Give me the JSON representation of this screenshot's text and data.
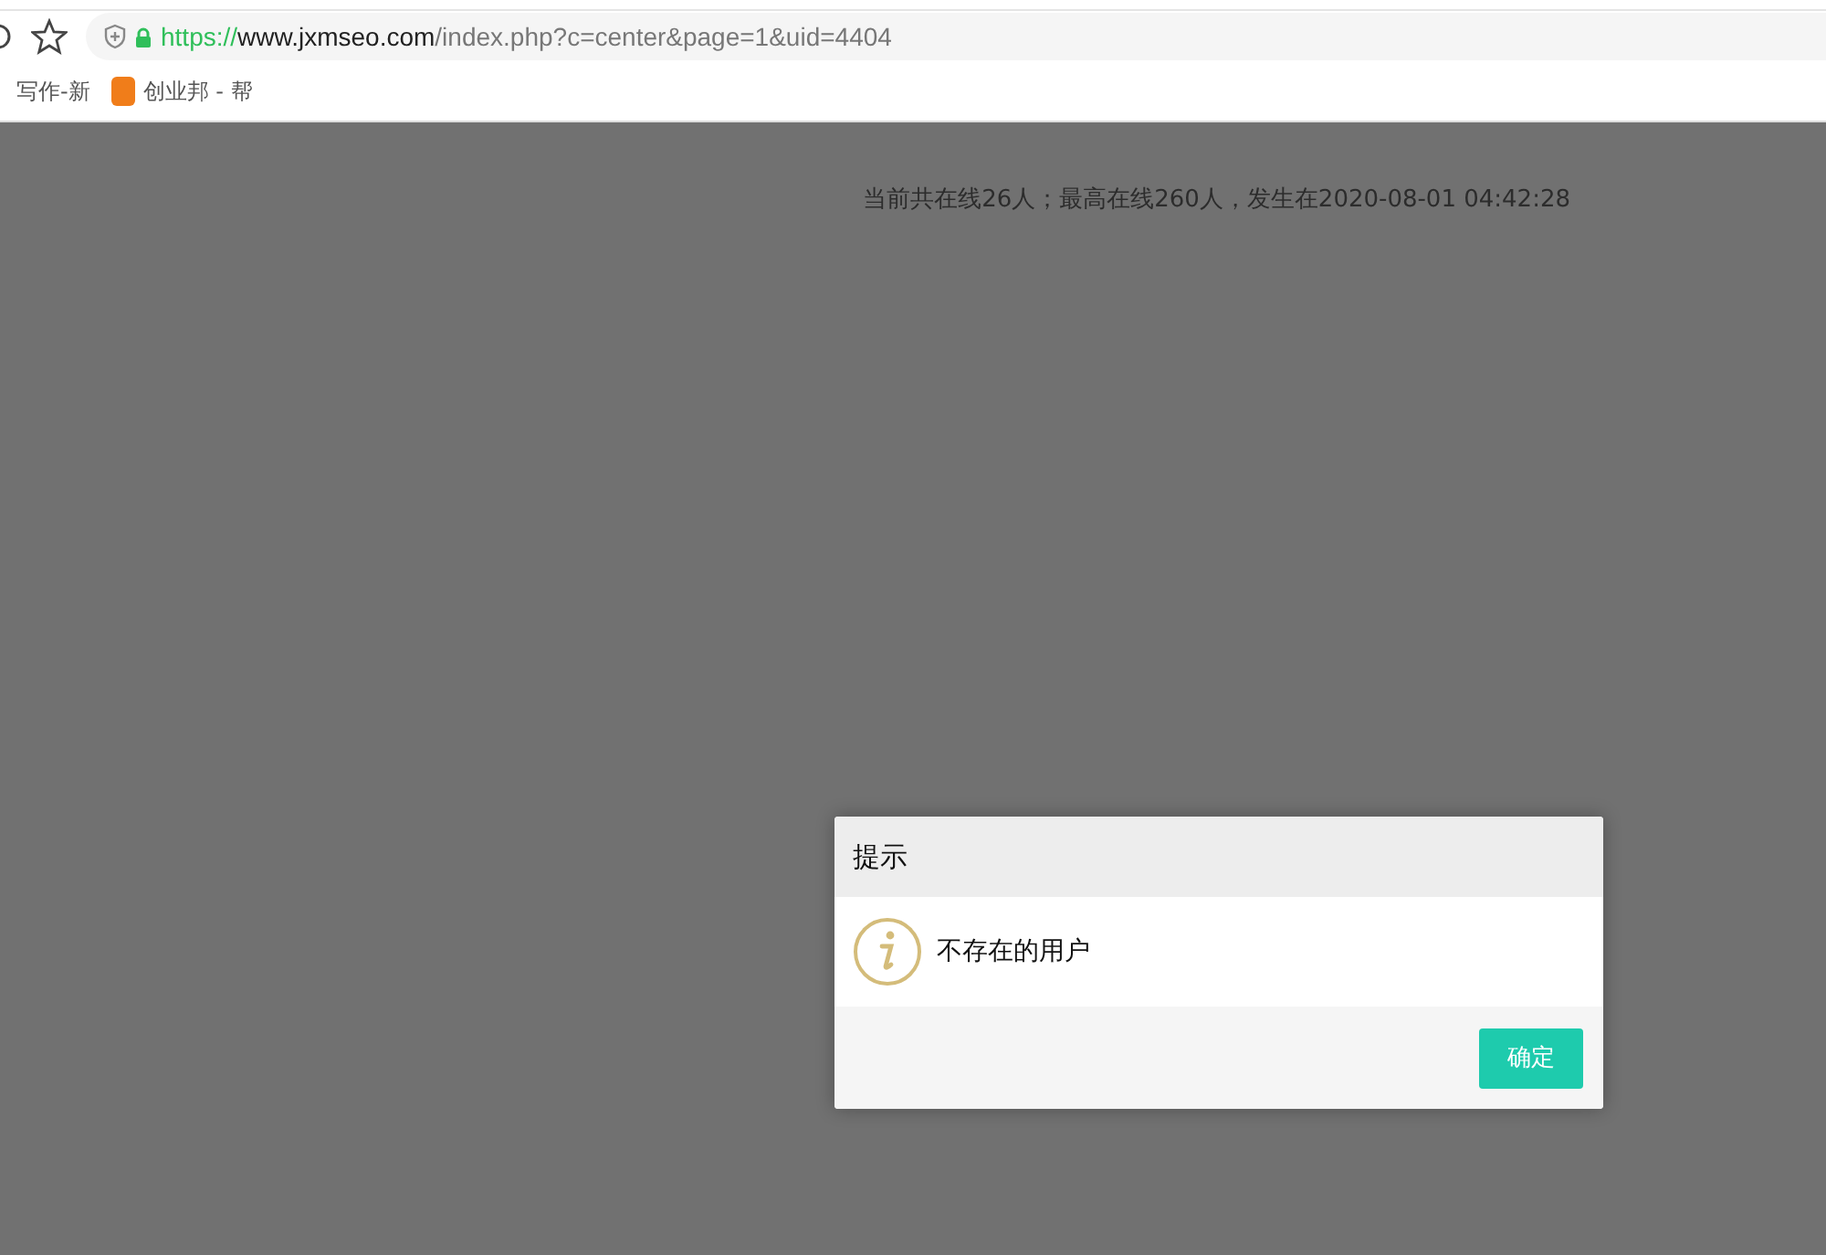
{
  "address_bar": {
    "scheme": "https://",
    "host": "www.jxmseo.com",
    "path": "/index.php?c=center&page=1&uid=4404"
  },
  "bookmarks": [
    {
      "label": "写作-新"
    },
    {
      "label": "创业邦 - 帮"
    }
  ],
  "online_status": "当前共在线26人；最高在线260人，发生在2020-08-01 04:42:28",
  "dialog": {
    "title": "提示",
    "message": "不存在的用户",
    "buttons": [
      "确定"
    ]
  }
}
